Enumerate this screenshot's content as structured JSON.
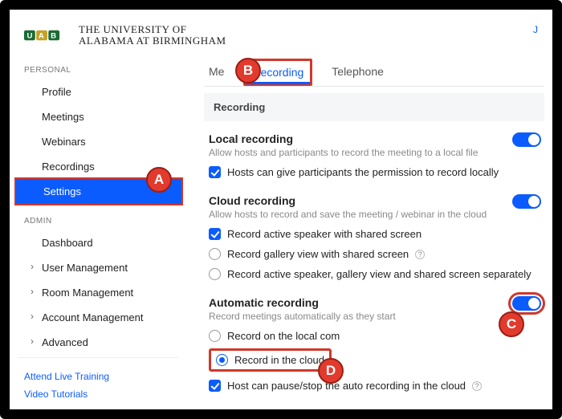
{
  "header": {
    "org_line1": "THE UNIVERSITY OF",
    "org_line2": "ALABAMA AT BIRMINGHAM",
    "join_partial": "J"
  },
  "sidebar": {
    "personal_label": "PERSONAL",
    "admin_label": "ADMIN",
    "personal": [
      {
        "label": "Profile"
      },
      {
        "label": "Meetings"
      },
      {
        "label": "Webinars"
      },
      {
        "label": "Recordings"
      },
      {
        "label": "Settings",
        "active": true
      }
    ],
    "admin": [
      {
        "label": "Dashboard"
      },
      {
        "label": "User Management",
        "sub": true
      },
      {
        "label": "Room Management",
        "sub": true
      },
      {
        "label": "Account Management",
        "sub": true
      },
      {
        "label": "Advanced",
        "sub": true
      }
    ],
    "links": [
      {
        "label": "Attend Live Training"
      },
      {
        "label": "Video Tutorials"
      }
    ]
  },
  "tabs": {
    "meeting": "Me",
    "recording": "Recording",
    "telephone": "Telephone"
  },
  "section": {
    "title": "Recording"
  },
  "local": {
    "title": "Local recording",
    "desc": "Allow hosts and participants to record the meeting to a local file",
    "opt1": "Hosts can give participants the permission to record locally"
  },
  "cloud": {
    "title": "Cloud recording",
    "desc": "Allow hosts to record and save the meeting / webinar in the cloud",
    "opt1": "Record active speaker with shared screen",
    "opt2": "Record gallery view with shared screen",
    "opt3": "Record active speaker, gallery view and shared screen separately"
  },
  "auto": {
    "title": "Automatic recording",
    "desc": "Record meetings automatically as they start",
    "opt1": "Record on the local com",
    "opt2": "Record in the cloud",
    "opt3": "Host can pause/stop the auto recording in the cloud"
  },
  "annotations": {
    "A": "A",
    "B": "B",
    "C": "C",
    "D": "D"
  }
}
